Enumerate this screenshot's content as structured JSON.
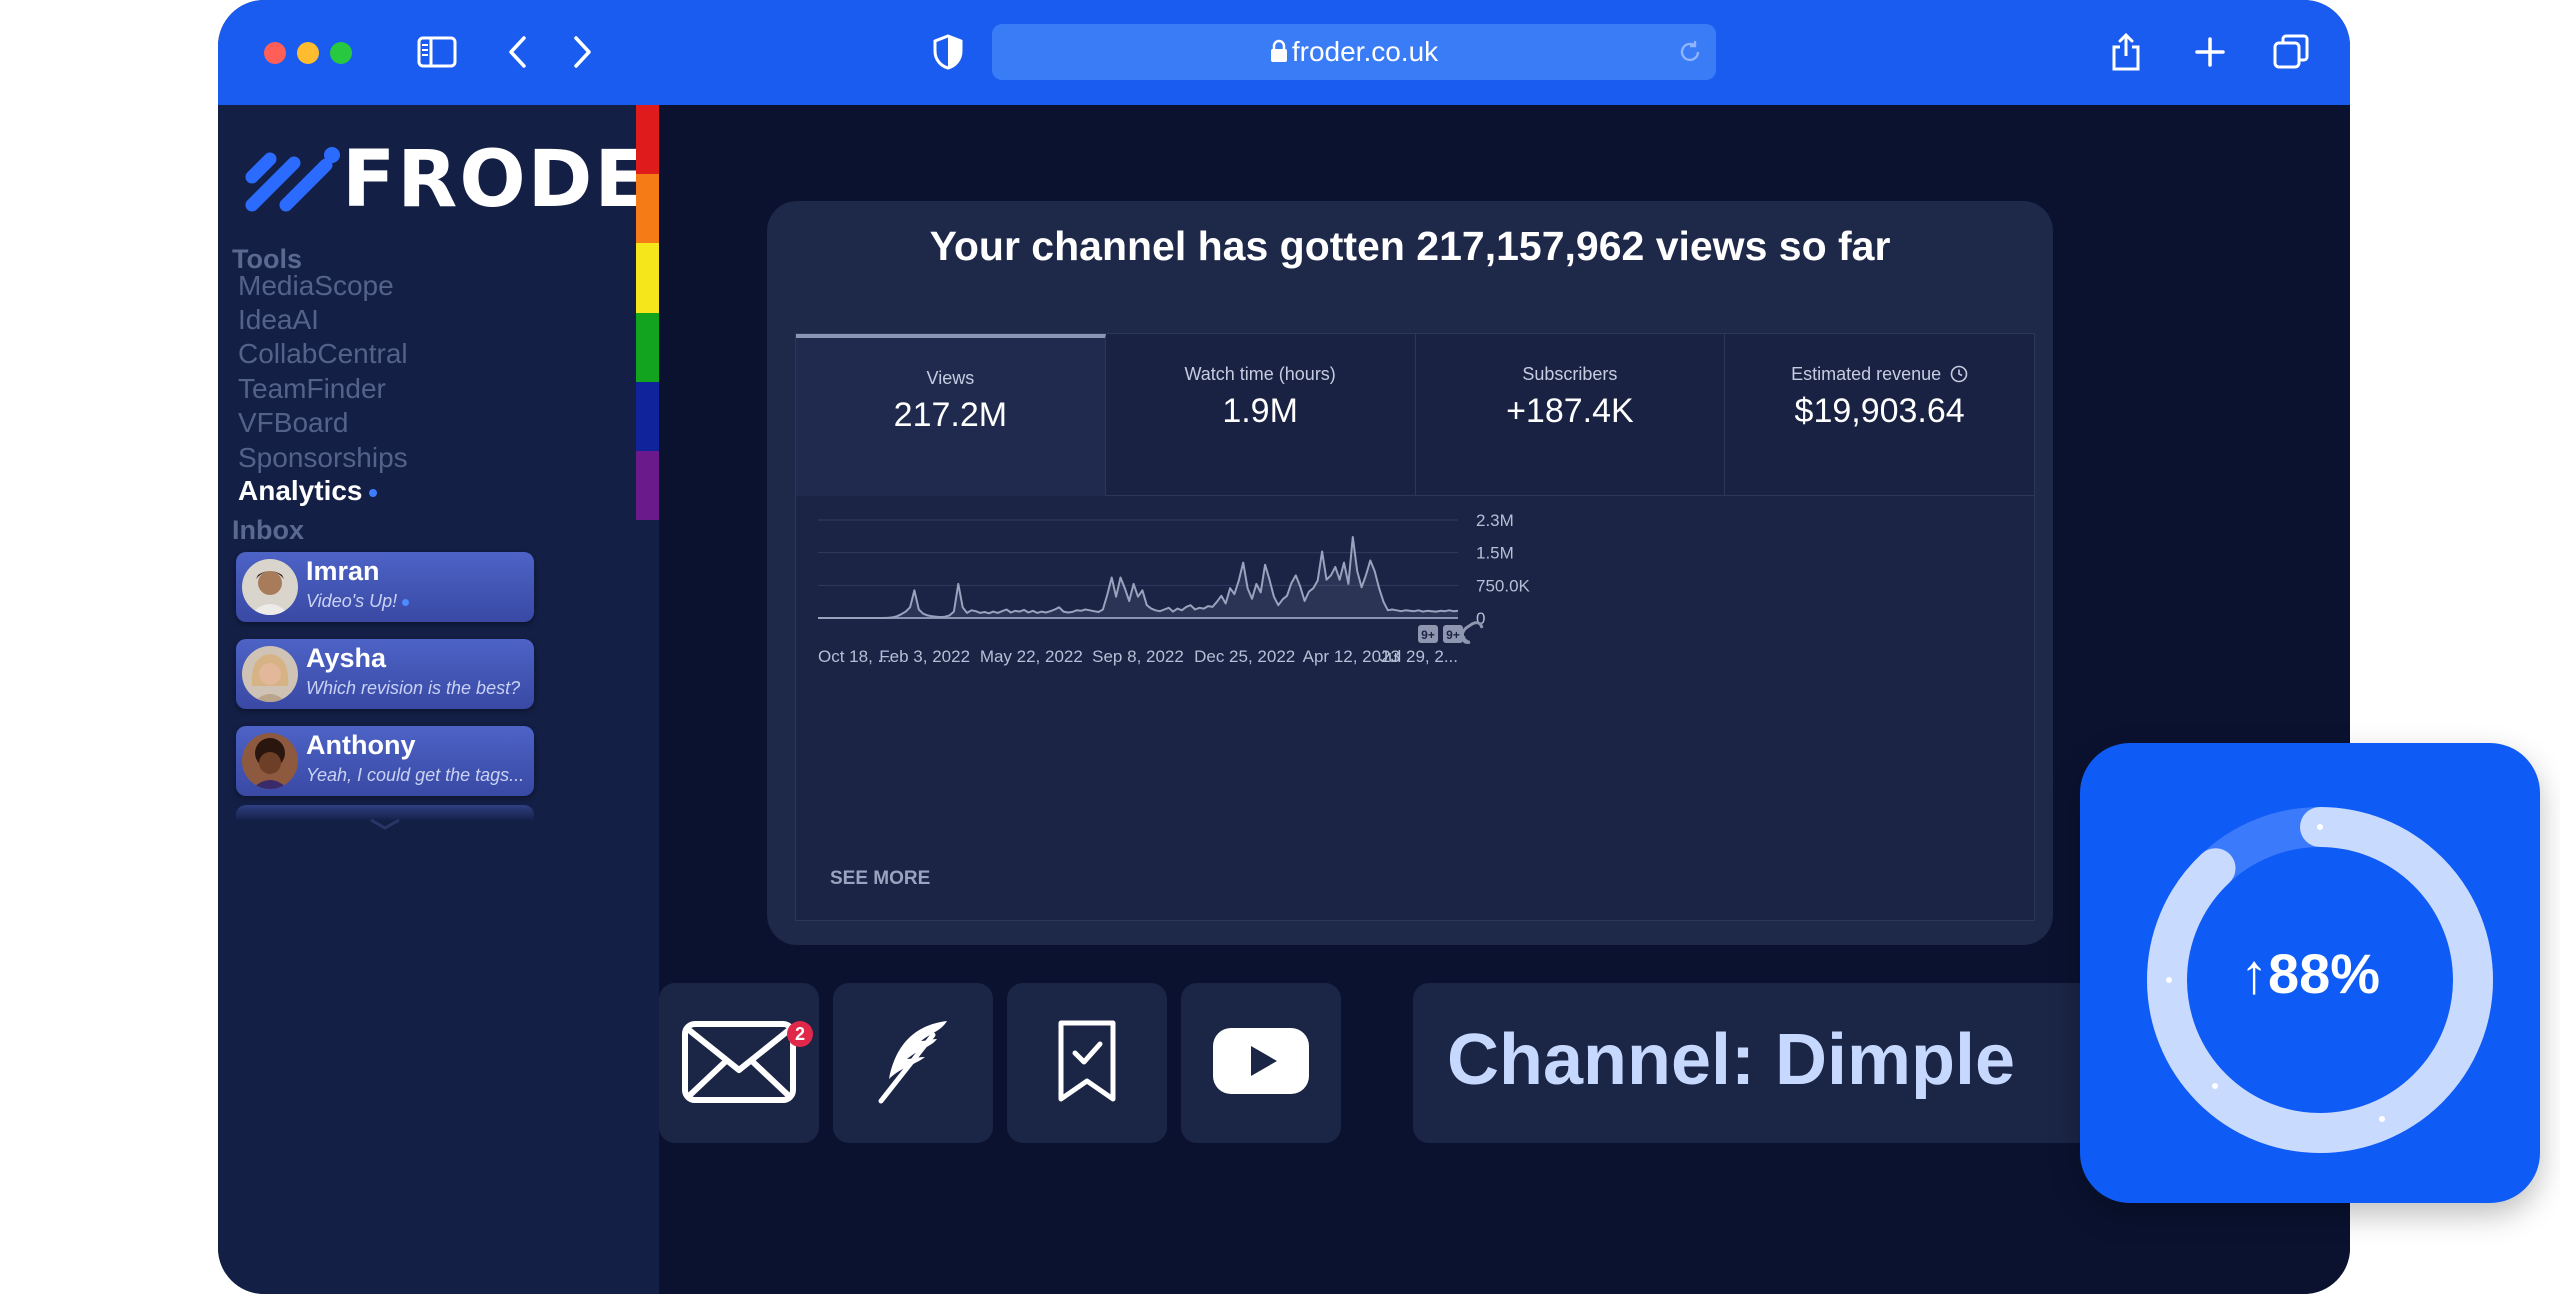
{
  "browser": {
    "url": "froder.co.uk",
    "traffic_lights": [
      "#ff5f57",
      "#febc2e",
      "#28c840"
    ],
    "accent": "#1a5cf0"
  },
  "sidebar": {
    "logo": "FRODER",
    "tools_title": "Tools",
    "tools": [
      "MediaScope",
      "IdeaAI",
      "CollabCentral",
      "TeamFinder",
      "VFBoard",
      "Sponsorships",
      "Analytics"
    ],
    "active_tool": "Analytics",
    "inbox_title": "Inbox",
    "messages": [
      {
        "name": "Imran",
        "preview": "Video's Up!",
        "unread": true
      },
      {
        "name": "Aysha",
        "preview": "Which revision is the best?"
      },
      {
        "name": "Anthony",
        "preview": "Yeah, I could get the tags..."
      }
    ],
    "rainbow": [
      "#e01b1b",
      "#f47b16",
      "#f5e51b",
      "#12a31f",
      "#10239a",
      "#6b1a8c"
    ]
  },
  "analytics": {
    "title": "Your channel has gotten 217,157,962 views so far",
    "stats": [
      {
        "label": "Views",
        "value": "217.2M"
      },
      {
        "label": "Watch time (hours)",
        "value": "1.9M"
      },
      {
        "label": "Subscribers",
        "value": "+187.4K"
      },
      {
        "label": "Estimated revenue",
        "value": "$19,903.64"
      }
    ],
    "see_more": "SEE MORE",
    "chart_badges": [
      "9+",
      "9+"
    ]
  },
  "chart_data": {
    "type": "line",
    "title": "",
    "xlabel": "",
    "ylabel": "",
    "x_tick_labels": [
      "Oct 18, ...",
      "Feb 3, 2022",
      "May 22, 2022",
      "Sep 8, 2022",
      "Dec 25, 2022",
      "Apr 12, 2023",
      "Jul 29, 2..."
    ],
    "y_tick_labels": [
      "2.3M",
      "1.5M",
      "750.0K",
      "0"
    ],
    "ylim": [
      0,
      2300000
    ],
    "grid": true,
    "series": [
      {
        "values": [
          0,
          0,
          0,
          0,
          0,
          0,
          0,
          0,
          0,
          0,
          0,
          0,
          0,
          0,
          0,
          0,
          5000,
          15000,
          40000,
          90000,
          150000,
          250000,
          650000,
          200000,
          100000,
          60000,
          40000,
          30000,
          20000,
          30000,
          60000,
          150000,
          800000,
          250000,
          120000,
          180000,
          160000,
          120000,
          140000,
          110000,
          150000,
          120000,
          160000,
          200000,
          130000,
          170000,
          150000,
          190000,
          130000,
          170000,
          120000,
          150000,
          130000,
          160000,
          200000,
          250000,
          150000,
          130000,
          140000,
          180000,
          170000,
          200000,
          180000,
          160000,
          140000,
          200000,
          550000,
          950000,
          500000,
          950000,
          700000,
          400000,
          800000,
          500000,
          650000,
          300000,
          220000,
          180000,
          160000,
          200000,
          240000,
          150000,
          220000,
          180000,
          260000,
          300000,
          200000,
          240000,
          220000,
          280000,
          260000,
          380000,
          520000,
          340000,
          700000,
          560000,
          880000,
          1300000,
          700000,
          450000,
          800000,
          600000,
          1250000,
          900000,
          500000,
          300000,
          440000,
          520000,
          820000,
          1000000,
          740000,
          400000,
          620000,
          700000,
          880000,
          1560000,
          900000,
          1000000,
          1200000,
          900000,
          1300000,
          800000,
          1900000,
          1100000,
          720000,
          1000000,
          1350000,
          1100000,
          700000,
          380000,
          180000,
          200000,
          180000,
          160000,
          180000,
          170000,
          160000,
          180000,
          150000,
          170000,
          160000,
          150000,
          170000,
          160000,
          180000,
          160000,
          170000
        ]
      }
    ]
  },
  "actions": {
    "mail_badge": "2",
    "icons": [
      "mail-icon",
      "feather-icon",
      "bookmark-check-icon",
      "youtube-play-icon"
    ],
    "channel_label": "Channel: Dimple"
  },
  "growth": {
    "value": "↑88%",
    "fraction": 0.88
  }
}
